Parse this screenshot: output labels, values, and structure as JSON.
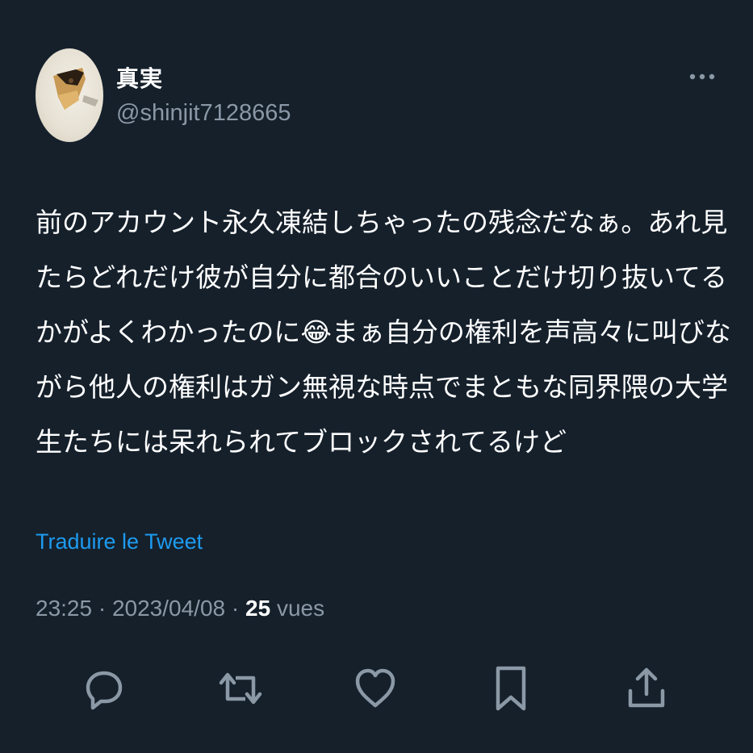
{
  "author": {
    "display_name": "真実",
    "handle": "@shinjit7128665"
  },
  "tweet": {
    "text": "前のアカウント永久凍結しちゃったの残念だなぁ。あれ見たらどれだけ彼が自分に都合のいいことだけ切り抜いてるかがよくわかったのに😂まぁ自分の権利を声高々に叫びながら他人の権利はガン無視な時点でまともな同界隈の大学生たちには呆れられてブロックされてるけど",
    "translate_label": "Traduire le Tweet",
    "time": "23:25",
    "separator": "·",
    "date": "2023/04/08",
    "views_count": "25",
    "views_label": "vues"
  },
  "actions": {
    "reply_icon": "reply-icon",
    "retweet_icon": "retweet-icon",
    "like_icon": "heart-icon",
    "bookmark_icon": "bookmark-icon",
    "share_icon": "share-icon",
    "more_icon": "more-icon"
  },
  "colors": {
    "background": "#15202b",
    "text": "#ffffff",
    "secondary": "#8b98a5",
    "link": "#1d9bf0"
  }
}
